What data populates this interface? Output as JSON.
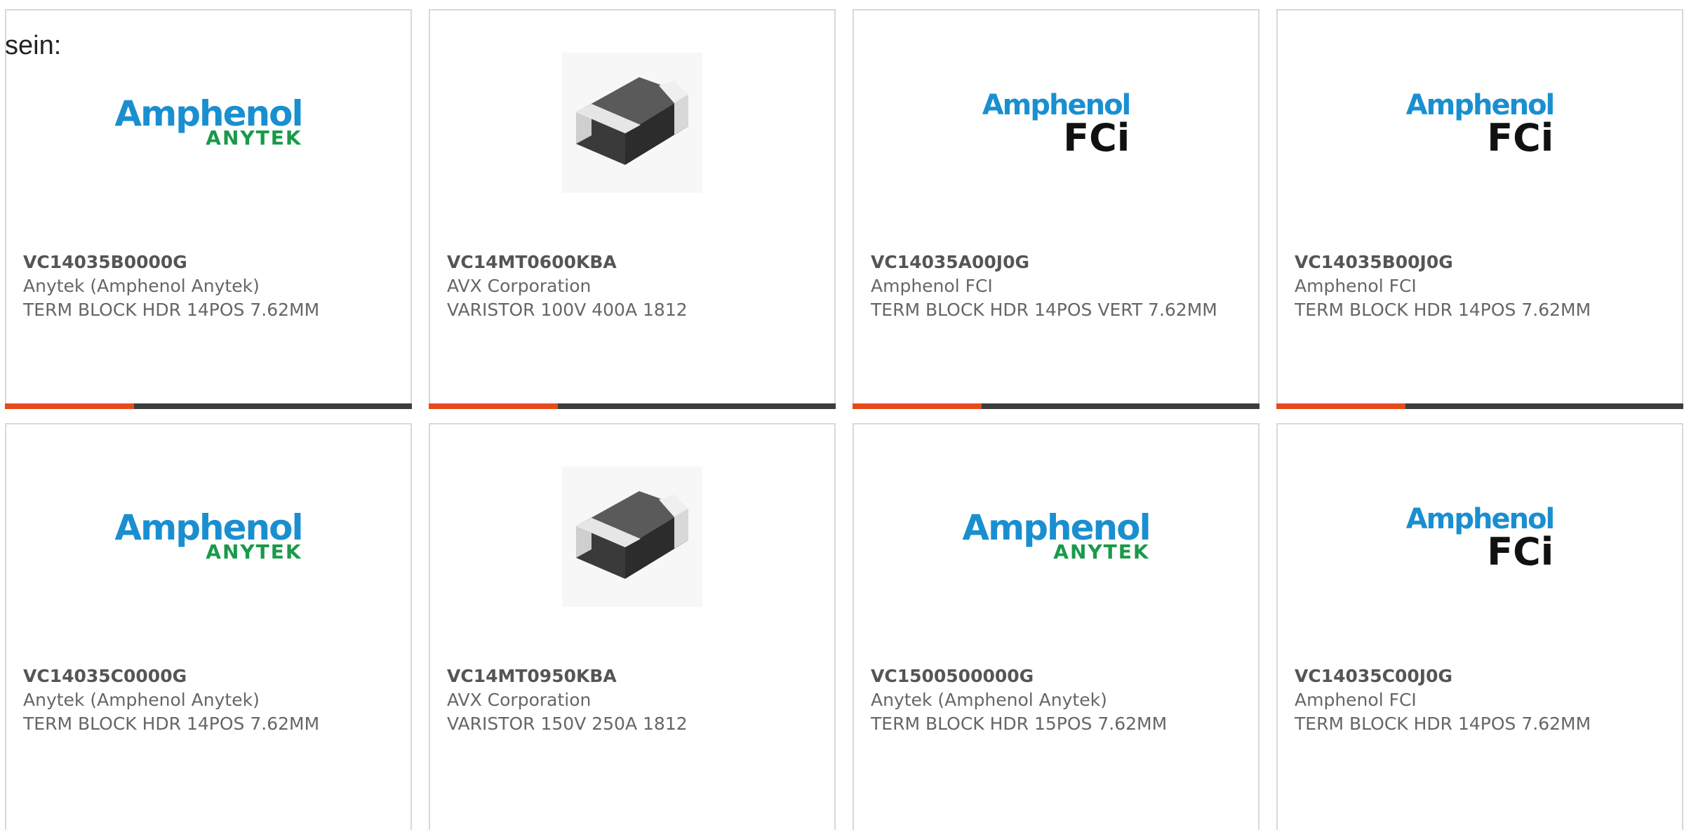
{
  "intro_text": "sein:",
  "colors": {
    "accent": "#e84a1c",
    "bar": "#3d3d3d",
    "border": "#d9d9d9",
    "amphenol_blue": "#1a8fd0",
    "anytek_green": "#1a9a4a"
  },
  "products": [
    {
      "part": "VC14035B0000G",
      "manufacturer": "Anytek (Amphenol Anytek)",
      "description": "TERM BLOCK HDR 14POS 7.62MM",
      "image": "amphenol-anytek-logo",
      "logo_top": "Amphenol",
      "logo_bottom": "ANYTEK"
    },
    {
      "part": "VC14MT0600KBA",
      "manufacturer": "AVX Corporation",
      "description": "VARISTOR 100V 400A 1812",
      "image": "smd-chip-photo",
      "logo_top": "",
      "logo_bottom": ""
    },
    {
      "part": "VC14035A00J0G",
      "manufacturer": "Amphenol FCI",
      "description": "TERM BLOCK HDR 14POS VERT 7.62MM",
      "image": "amphenol-fci-logo",
      "logo_top": "Amphenol",
      "logo_bottom": "FCi"
    },
    {
      "part": "VC14035B00J0G",
      "manufacturer": "Amphenol FCI",
      "description": "TERM BLOCK HDR 14POS 7.62MM",
      "image": "amphenol-fci-logo",
      "logo_top": "Amphenol",
      "logo_bottom": "FCi"
    },
    {
      "part": "VC14035C0000G",
      "manufacturer": "Anytek (Amphenol Anytek)",
      "description": "TERM BLOCK HDR 14POS 7.62MM",
      "image": "amphenol-anytek-logo",
      "logo_top": "Amphenol",
      "logo_bottom": "ANYTEK"
    },
    {
      "part": "VC14MT0950KBA",
      "manufacturer": "AVX Corporation",
      "description": "VARISTOR 150V 250A 1812",
      "image": "smd-chip-photo",
      "logo_top": "",
      "logo_bottom": ""
    },
    {
      "part": "VC1500500000G",
      "manufacturer": "Anytek (Amphenol Anytek)",
      "description": "TERM BLOCK HDR 15POS 7.62MM",
      "image": "amphenol-anytek-logo",
      "logo_top": "Amphenol",
      "logo_bottom": "ANYTEK"
    },
    {
      "part": "VC14035C00J0G",
      "manufacturer": "Amphenol FCI",
      "description": "TERM BLOCK HDR 14POS 7.62MM",
      "image": "amphenol-fci-logo",
      "logo_top": "Amphenol",
      "logo_bottom": "FCi"
    }
  ]
}
